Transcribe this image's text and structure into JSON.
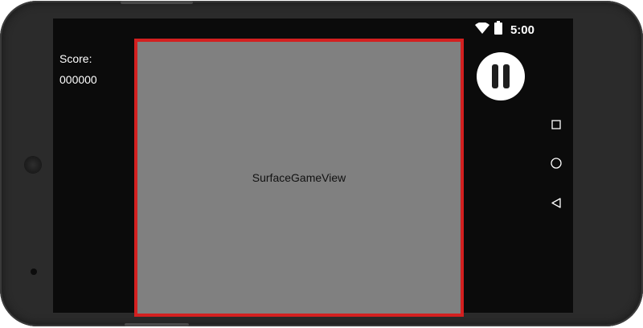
{
  "status_bar": {
    "time": "5:00",
    "icons": [
      "wifi-icon",
      "battery-icon"
    ]
  },
  "hud": {
    "score_label": "Score:",
    "score_value": "000000"
  },
  "game_view": {
    "label": "SurfaceGameView",
    "background": "#808080",
    "border_color": "#d32020"
  },
  "pause_button": {
    "icon": "pause-icon"
  },
  "nav_buttons": [
    "recents-icon",
    "home-icon",
    "back-icon"
  ]
}
